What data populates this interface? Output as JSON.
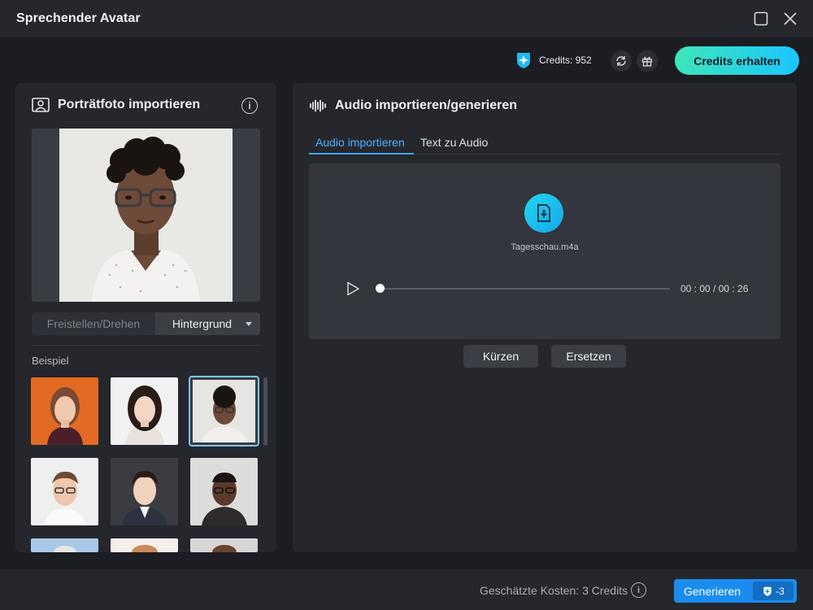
{
  "window": {
    "title": "Sprechender Avatar"
  },
  "topbar": {
    "credits_label": "Credits: 952",
    "get_credits_label": "Credits erhalten"
  },
  "left_panel": {
    "title": "Porträtfoto importieren",
    "info_glyph": "i",
    "segment": {
      "crop_rotate": "Freistellen/Drehen",
      "background": "Hintergrund"
    },
    "examples_label": "Beispiel"
  },
  "right_panel": {
    "title": "Audio importieren/generieren",
    "tabs": [
      {
        "label": "Audio importieren",
        "active": true
      },
      {
        "label": "Text zu Audio",
        "active": false
      }
    ],
    "audio": {
      "file_name": "Tagesschau.m4a",
      "time": "00 : 00 / 00 : 26",
      "progress": 0.0
    },
    "buttons": {
      "cut": "Kürzen",
      "replace": "Ersetzen"
    }
  },
  "footer": {
    "cost_label": "Geschätzte Kosten: 3 Credits",
    "info_glyph": "i",
    "generate_label": "Generieren",
    "generate_cost": "-3"
  },
  "colors": {
    "accent_blue": "#3fa6ff",
    "credits_gradient_start": "#3ee6b9",
    "credits_gradient_end": "#19c6ff",
    "generate_button": "#1a8cf0"
  },
  "icons": {
    "portrait": "portrait-icon",
    "audio": "audio-wave-icon",
    "file": "audio-file-icon",
    "play": "play-icon",
    "credits": "credits-gem-icon",
    "refresh": "refresh-icon",
    "gift": "gift-icon"
  }
}
